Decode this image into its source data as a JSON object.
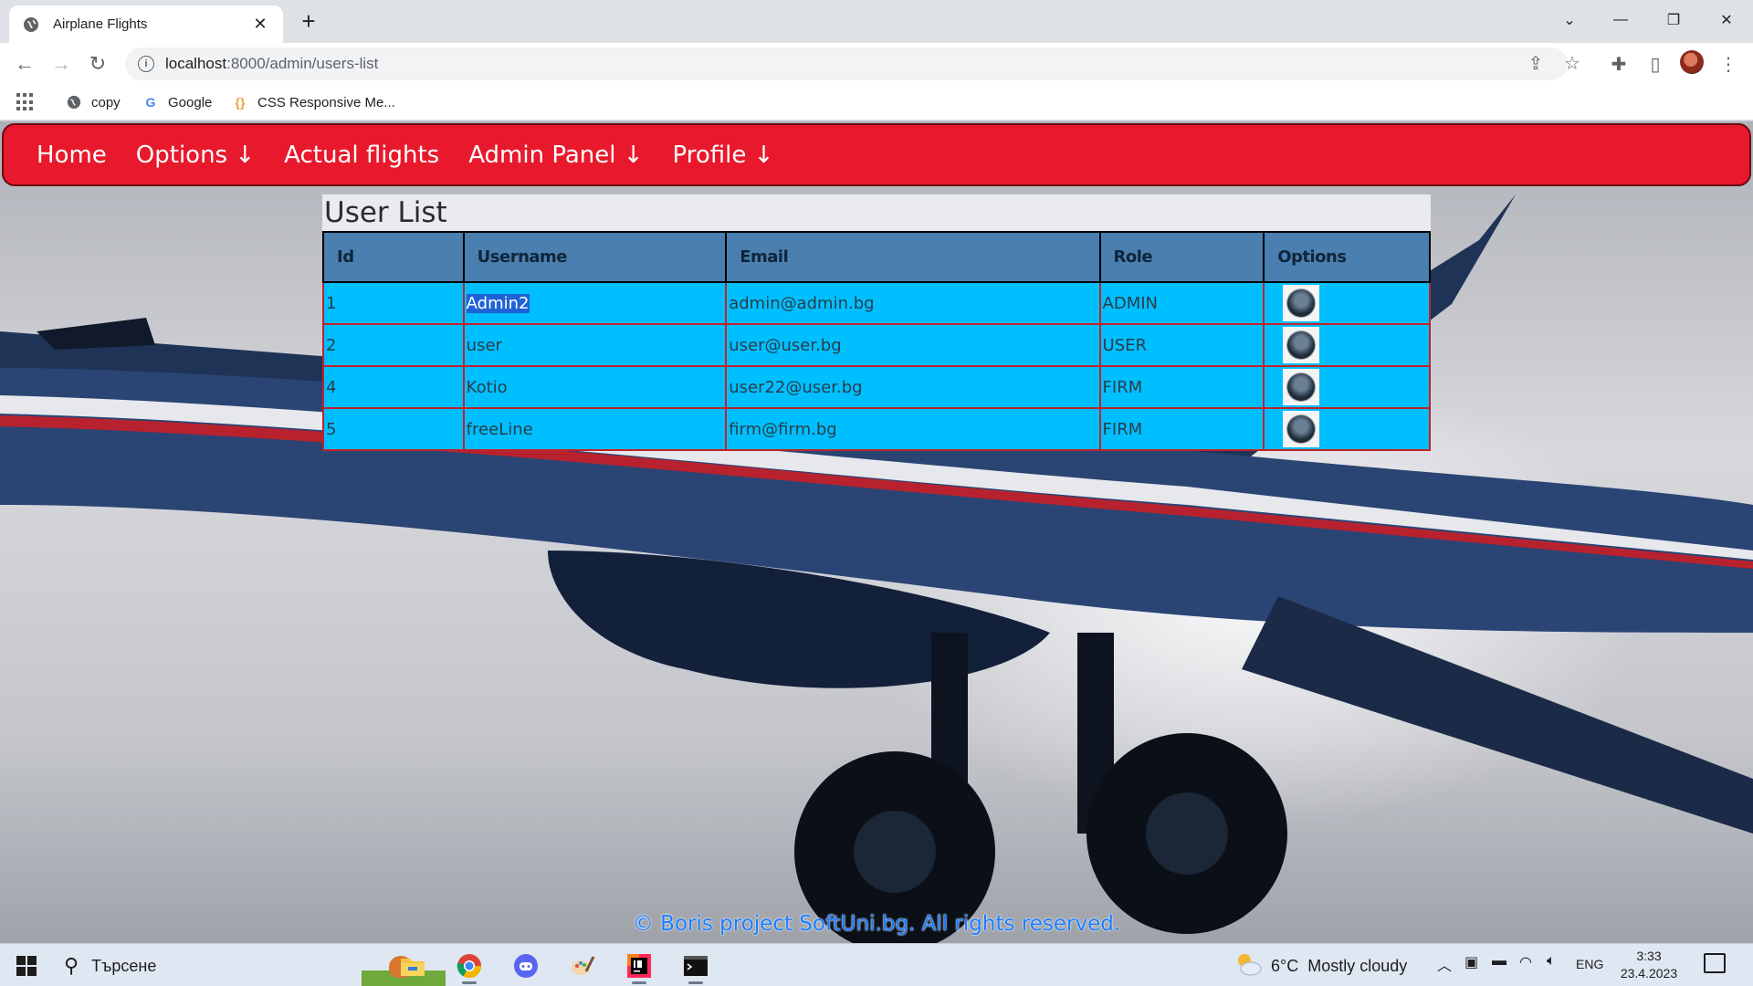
{
  "browser": {
    "tab_title": "Airplane Flights",
    "url_host": "localhost",
    "url_path": ":8000/admin/users-list",
    "bookmarks": [
      {
        "label": "copy",
        "icon": "globe-icon"
      },
      {
        "label": "Google",
        "icon": "google-icon"
      },
      {
        "label": "CSS Responsive Me...",
        "icon": "code-braces-icon"
      }
    ]
  },
  "nav": {
    "items": [
      "Home",
      "Options ↓",
      "Actual flights",
      "Admin Panel ↓",
      "Profile ↓"
    ]
  },
  "page": {
    "title": "User List",
    "columns": [
      "Id",
      "Username",
      "Email",
      "Role",
      "Options"
    ],
    "rows": [
      {
        "id": "1",
        "username": "Admin2",
        "email": "admin@admin.bg",
        "role": "ADMIN"
      },
      {
        "id": "2",
        "username": "user",
        "email": "user@user.bg",
        "role": "USER"
      },
      {
        "id": "4",
        "username": "Kotio",
        "email": "user22@user.bg",
        "role": "FIRM"
      },
      {
        "id": "5",
        "username": "freeLine",
        "email": "firm@firm.bg",
        "role": "FIRM"
      }
    ],
    "footer": "© Boris project SoftUni.bg. All rights reserved."
  },
  "taskbar": {
    "search_placeholder": "Търсене",
    "weather": "6°C  Mostly cloudy",
    "lang": "ENG",
    "time": "3:33",
    "date": "23.4.2023 г."
  },
  "colors": {
    "navbar": "#e8192c",
    "table_header": "#4a7fb0",
    "table_row": "#00bfff",
    "row_border": "#c0222c",
    "footer_text": "#1a7cff"
  }
}
